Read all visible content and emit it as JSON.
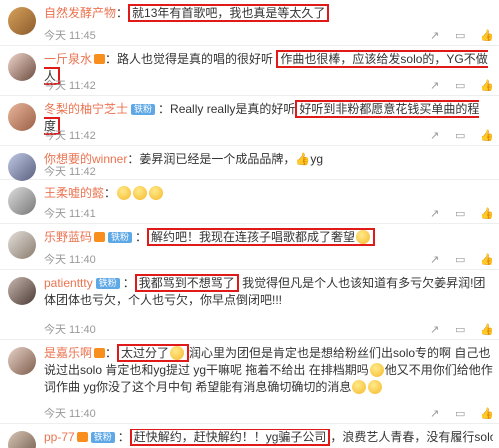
{
  "comments": [
    {
      "user": "自然发酵产物",
      "colon": "：",
      "text": "就13年有首歌吧，我也真是等太久了",
      "time": "今天 11:45",
      "badge": "",
      "vip": false,
      "lv": ""
    },
    {
      "user": "一斤泉水",
      "colon": "：",
      "text": "路人也觉得是真的唱的很好听",
      "text2": "作曲也很棒，应该给发solo的，YG不做人",
      "time": "今天 11:42",
      "badge": "",
      "vip": true,
      "lv": ""
    },
    {
      "user": "冬梨的柚宁芝士",
      "colon": "：",
      "text": "Really really是真的好听",
      "text2": "好听到非粉都愿意花钱买单曲的程度",
      "time": "今天 11:42",
      "badge": "铁粉",
      "vip": false,
      "lv": ""
    },
    {
      "user": "你想要的winner",
      "colon": "：",
      "text": "姜昇润已经是一个成品品牌，",
      "text2": "yg",
      "time": "今天 11:42",
      "badge": "",
      "vip": false,
      "lv": ""
    },
    {
      "user": "王柔嘘的懿",
      "colon": "：",
      "text": "",
      "time": "今天 11:41",
      "badge": "铁粉",
      "vip": false,
      "lv": ""
    },
    {
      "user": "乐野蓝码",
      "badge": "铁粉",
      "colon": "：",
      "text": "解约吧！我现在连孩子唱歌都成了奢望",
      "time": "今天 11:40",
      "vip": true,
      "lv": ""
    },
    {
      "user": "patienttty",
      "badge": "铁粉",
      "colon": "：",
      "text": "我都骂到不想骂了",
      "text2": "我觉得但凡是个人也该知道有多亏欠姜昇润!团体团体也亏欠，个人也亏欠，你早点倒闭吧!!!",
      "time": "今天 11:40",
      "vip": false,
      "lv": ""
    },
    {
      "user": "是嘉乐啊",
      "badge": "",
      "colon": "：",
      "text": "太过分了",
      "text2": "润心里为团但是肯定也是想给粉丝们出solo专的啊 自己也说过出solo 肯定也和yg提过 yg干嘛呢 拖着不给出 在排档期吗",
      "text3": "他又不用你们给他作词作曲 yg你没了这个月中旬 希望能有消息确切确切的消息",
      "time": "今天 11:40",
      "vip": true,
      "lv": ""
    },
    {
      "user": "pp-77",
      "badge": "铁粉",
      "colon": "：",
      "text": "赶快解约，赶快解约！！yg骗子公司",
      "text2": "，浪费艺人青春，没有履行solo合同里的任何",
      "time": "",
      "vip": true,
      "lv": ""
    }
  ],
  "actions": {
    "share_icon": "share-icon",
    "comment_icon": "comment-icon",
    "like_icon": "like-icon"
  },
  "colors": {
    "username": "#eb7350",
    "highlight_border": "#e01919",
    "badge_bg": "#5fa8e6"
  }
}
